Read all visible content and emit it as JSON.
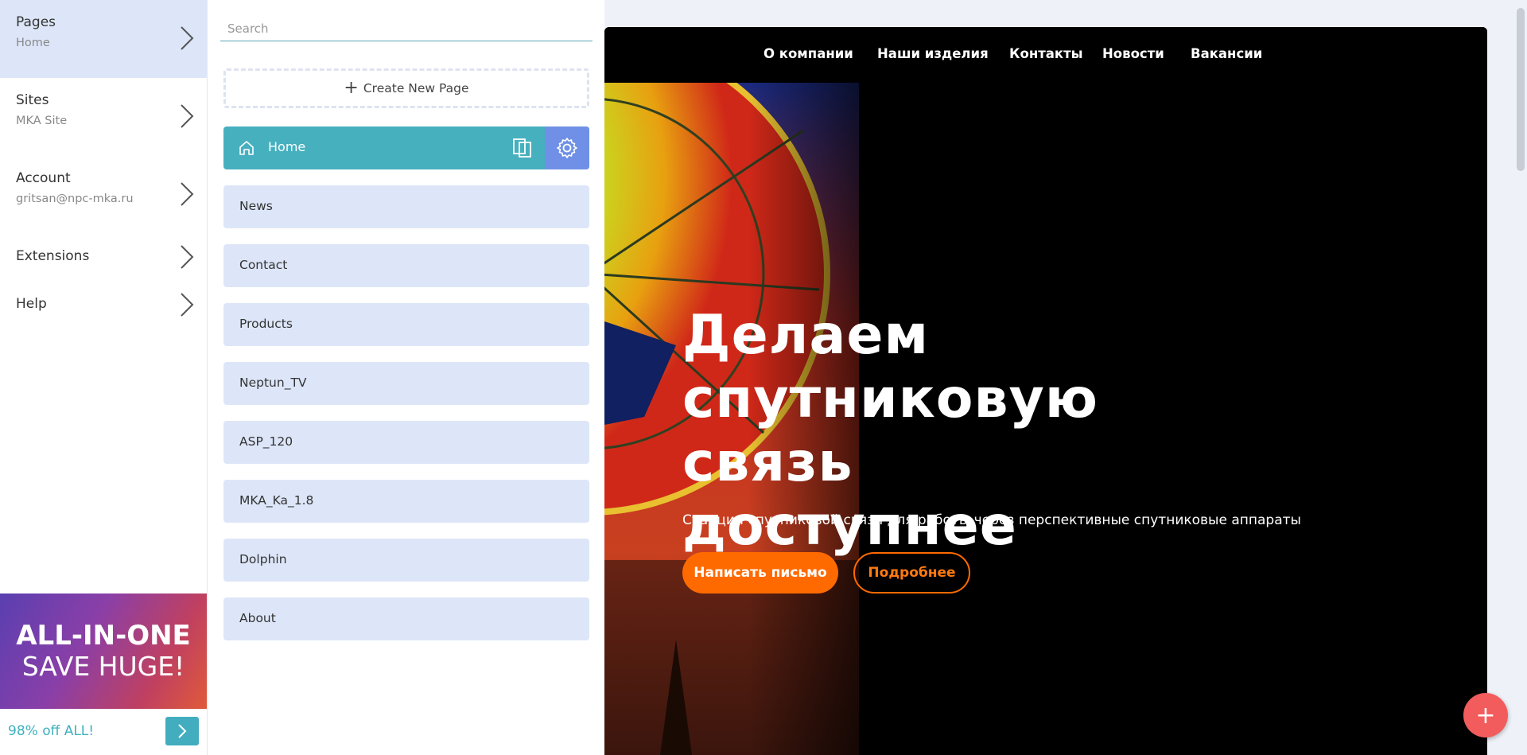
{
  "leftnav": {
    "items": [
      {
        "title": "Pages",
        "sub": "Home"
      },
      {
        "title": "Sites",
        "sub": "MKA Site"
      },
      {
        "title": "Account",
        "sub": "gritsan@npc-mka.ru"
      },
      {
        "title": "Extensions"
      },
      {
        "title": "Help"
      }
    ],
    "promo": {
      "line1": "ALL-IN-ONE",
      "line2": "SAVE HUGE!",
      "offer": "98% off ALL!"
    }
  },
  "panel": {
    "search_placeholder": "Search",
    "create_label": "Create New Page",
    "home_label": "Home",
    "pages": [
      "News",
      "Contact",
      "Products",
      "Neptun_TV",
      "ASP_120",
      "MKA_Ka_1.8",
      "Dolphin",
      "About"
    ]
  },
  "preview": {
    "nav": [
      "О компании",
      "Наши изделия",
      "Контакты",
      "Новости",
      "Вакансии"
    ],
    "hero_title": [
      "Делаем",
      "спутниковую связь",
      "доступнее"
    ],
    "hero_sub": "Станции спутниковой связи для работы через перспективные спутниковые аппараты",
    "btn_primary": "Написать письмо",
    "btn_secondary": "Подробнее"
  },
  "colors": {
    "accent": "#46b0bf",
    "orange": "#ff6a00",
    "fab": "#f25c5c",
    "gear_bg": "#6f90e6",
    "row_bg": "#dde6f8"
  }
}
